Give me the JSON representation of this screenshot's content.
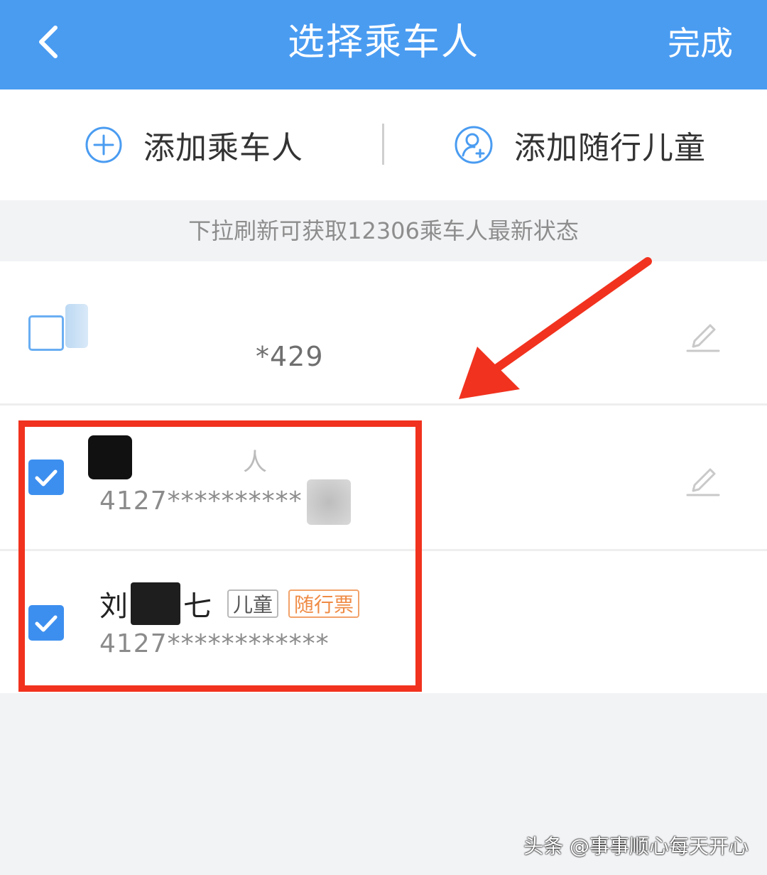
{
  "header": {
    "title": "选择乘车人",
    "done_label": "完成"
  },
  "actions": {
    "add_passenger": "添加乘车人",
    "add_child": "添加随行儿童"
  },
  "hint": "下拉刷新可获取12306乘车人最新状态",
  "passengers": [
    {
      "name": "",
      "id_masked": "*429",
      "checked": false
    },
    {
      "name": "",
      "name_suffix": "人",
      "id_masked": "4127**********",
      "checked": true
    },
    {
      "name_prefix": "刘",
      "name_suffix": "七",
      "tags": [
        "儿童",
        "随行票"
      ],
      "id_masked": "4127************",
      "checked": true
    }
  ],
  "watermark": "头条 @事事顺心每天开心",
  "colors": {
    "header_bg": "#4a9cf1",
    "checkbox": "#3d8fef",
    "annotation_red": "#f1321e",
    "companion_tag": "#ef8b45"
  },
  "icons": {
    "back": "chevron-left-icon",
    "add": "plus-circle-icon",
    "add_child": "user-plus-icon",
    "edit": "pencil-icon",
    "check": "checkmark-icon"
  }
}
